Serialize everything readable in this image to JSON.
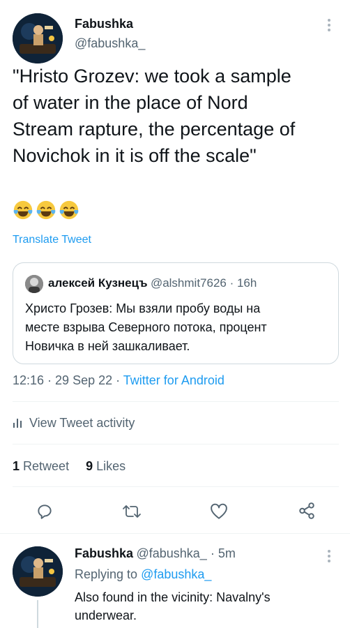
{
  "tweet": {
    "display_name": "Fabushka",
    "handle": "@fabushka_",
    "text_lines": [
      "\"Hristo Grozev: we took a sample",
      "of water in the place of Nord",
      "Stream rapture, the percentage of",
      "Novichok in it is off the scale\""
    ],
    "emojis": [
      "😂",
      "😂",
      "😂"
    ],
    "translate_label": "Translate Tweet",
    "timestamp": "12:16 · 29 Sep 22 · ",
    "source": "Twitter for Android",
    "activity_label": "View Tweet activity",
    "retweets_count": "1",
    "retweets_label": "Retweet",
    "likes_count": "9",
    "likes_label": "Likes"
  },
  "quote": {
    "display_name": "алексей Кузнецъ",
    "handle_time": "@alshmit7626 · 16h",
    "text_lines": [
      "Христо Грозев: Мы взяли пробу воды на",
      "месте взрыва Северного потока, процент",
      "Новичка в ней зашкаливает."
    ]
  },
  "actions": [
    "reply-icon",
    "retweet-icon",
    "like-icon",
    "share-icon"
  ],
  "reply": {
    "display_name": "Fabushka",
    "handle_time": "@fabushka_ · 5m",
    "replying_prefix": "Replying to ",
    "replying_to": "@fabushka_",
    "text_lines": [
      "Also found in the vicinity: Navalny's",
      "underwear."
    ]
  },
  "colors": {
    "accent": "#1d9bf0",
    "secondary_text": "#536471",
    "border": "#cfd9de",
    "like": "#f91880"
  }
}
